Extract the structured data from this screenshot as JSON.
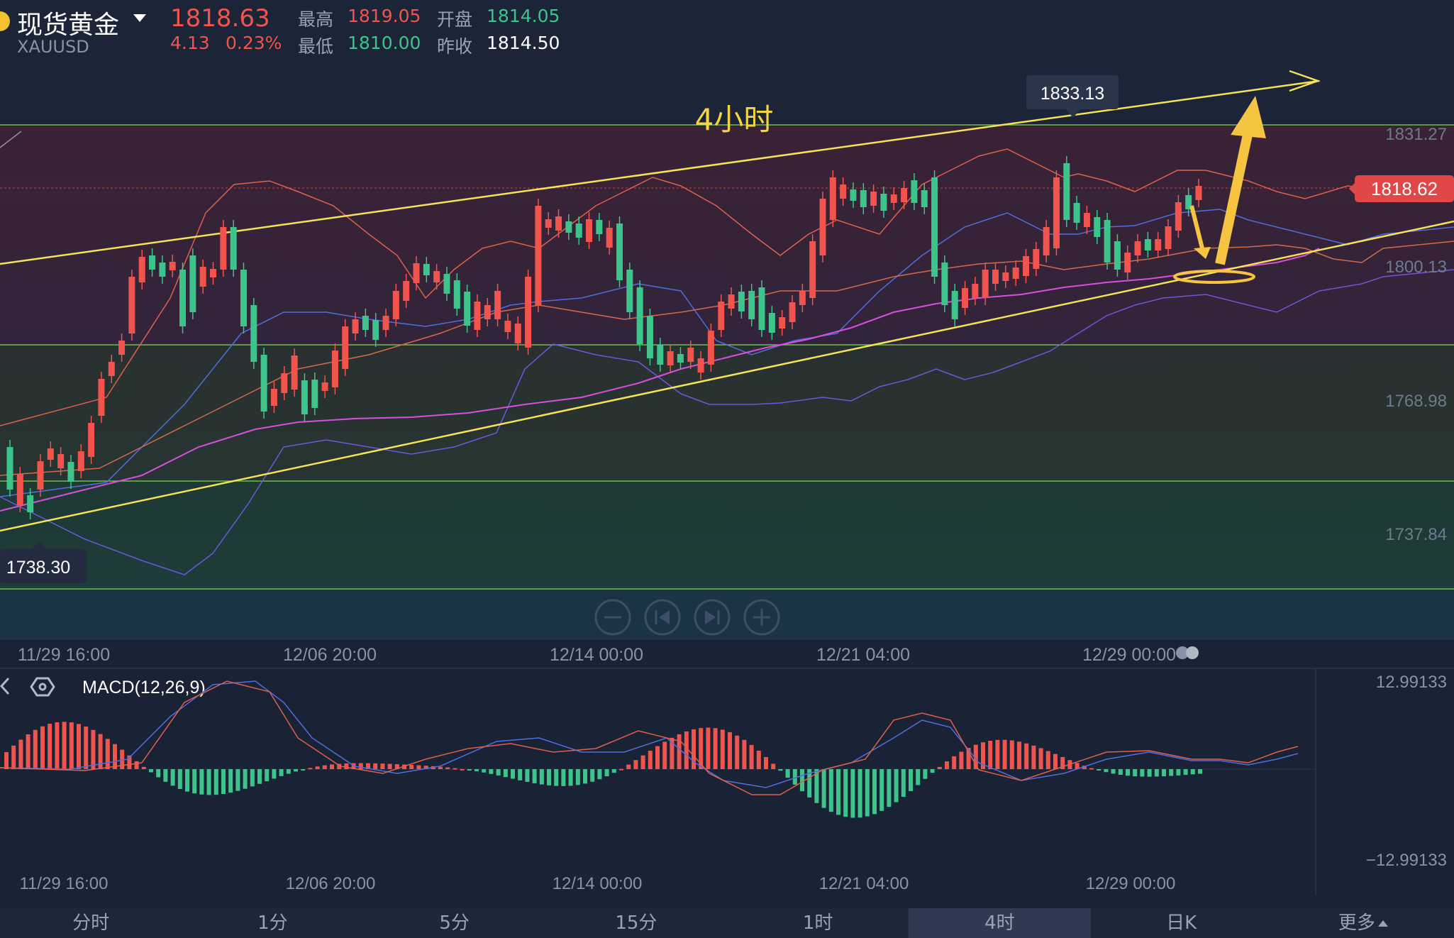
{
  "header": {
    "instrument_name": "现货黄金",
    "instrument_code": "XAUUSD",
    "last_price": "1818.63",
    "change": "4.13",
    "change_percent": "0.23%",
    "high_label": "最高",
    "high_value": "1819.05",
    "low_label": "最低",
    "low_value": "1810.00",
    "open_label": "开盘",
    "open_value": "1814.05",
    "prev_close_label": "昨收",
    "prev_close_value": "1814.50"
  },
  "chart": {
    "annotation_title": "4小时",
    "current_price_tag": "1818.62",
    "high_marker": "1833.13",
    "low_marker": "1738.30",
    "price_axis": [
      "1831.27",
      "1800.13",
      "1768.98",
      "1737.84"
    ],
    "time_axis": [
      "11/29 16:00",
      "12/06 20:00",
      "12/14 00:00",
      "12/21 04:00",
      "12/29 00:00"
    ],
    "zoom_controls": [
      "zoom-out",
      "step-back",
      "step-forward",
      "zoom-in"
    ]
  },
  "macd": {
    "label": "MACD(12,26,9)",
    "axis_top": "12.99133",
    "axis_bottom": "−12.99133",
    "time_axis": [
      "11/29 16:00",
      "12/06 20:00",
      "12/14 00:00",
      "12/21 04:00",
      "12/29 00:00"
    ]
  },
  "tabs": [
    {
      "label": "分时"
    },
    {
      "label": "1分"
    },
    {
      "label": "5分"
    },
    {
      "label": "15分"
    },
    {
      "label": "1时"
    },
    {
      "label": "4时"
    },
    {
      "label": "日K"
    },
    {
      "label": "更多"
    }
  ],
  "colors": {
    "up": "#f1544c",
    "down": "#3dc48a",
    "trendline": "#f5e25a",
    "ma_purple": "#d84fe0",
    "ma_blue": "#4f6ee0",
    "ma_orange": "#e06a4a"
  },
  "chart_data": {
    "type": "candlestick",
    "interval": "4时",
    "price_ticks": [
      1831.27,
      1800.13,
      1768.98,
      1737.84
    ],
    "high": 1833.13,
    "low": 1738.3,
    "last": 1818.62
  }
}
